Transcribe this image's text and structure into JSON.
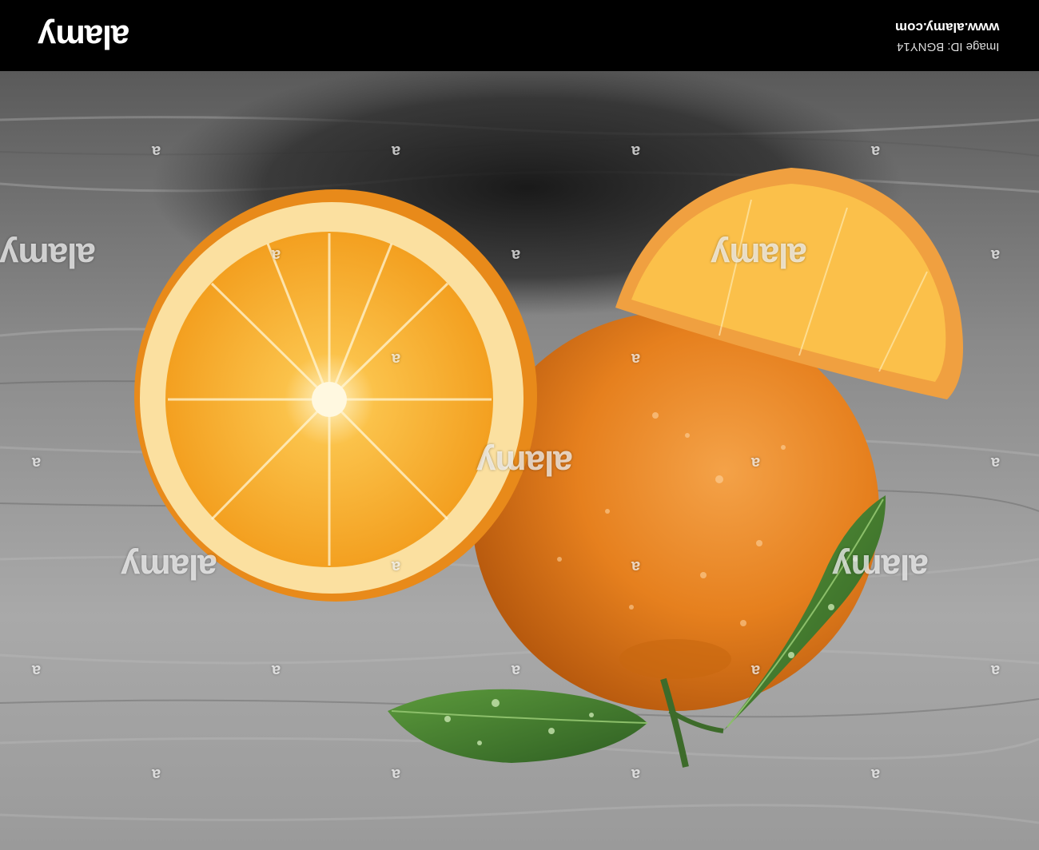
{
  "banner": {
    "logo_text": "alamy",
    "url_text": "www.alamy.com",
    "image_id_text": "Image ID: BGNY14"
  },
  "watermark": {
    "large_text": "alamy",
    "small_text": "a"
  },
  "colors": {
    "banner_bg": "#000000",
    "slate_surface": "#8c8c8c",
    "orange_peel": "#e8801f",
    "orange_flesh": "#f7a92a",
    "leaf_green": "#3f7a2c"
  }
}
